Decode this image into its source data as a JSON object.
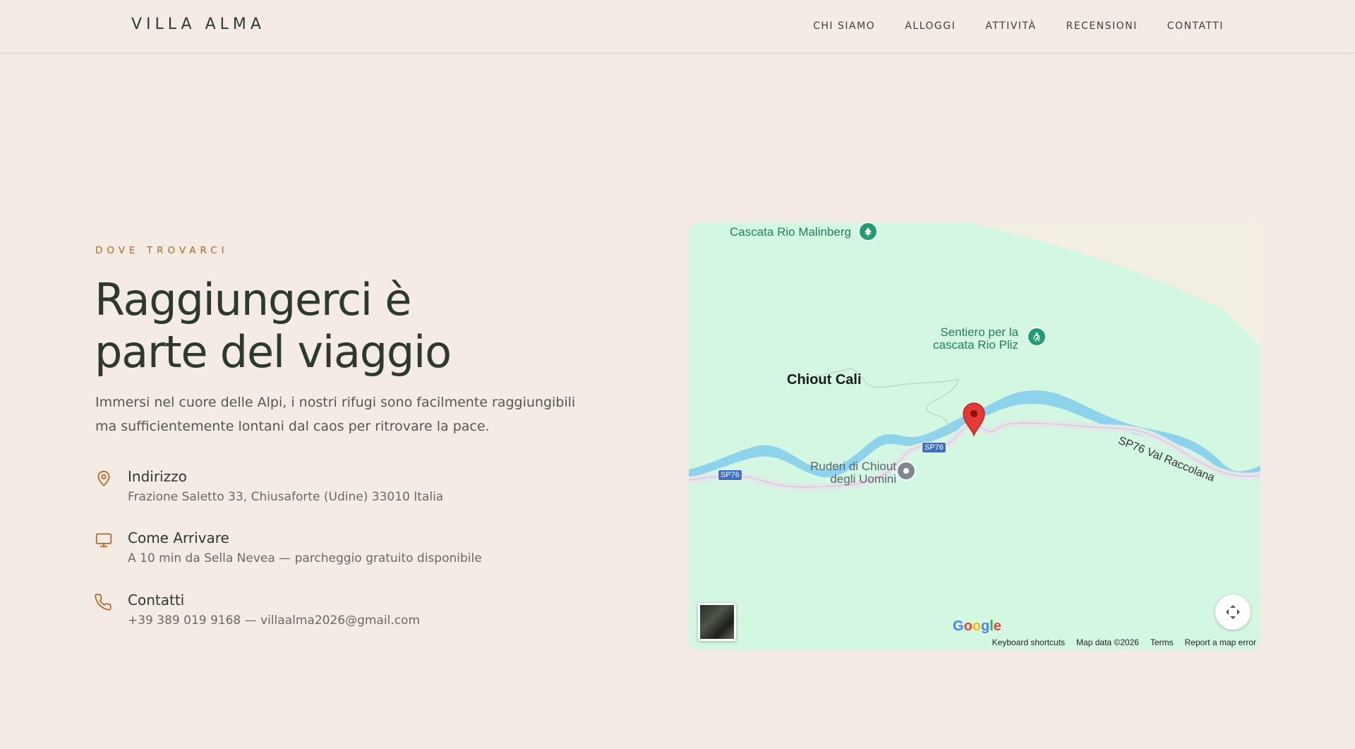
{
  "header": {
    "logo": "VILLA ALMA",
    "nav": [
      "CHI SIAMO",
      "ALLOGGI",
      "ATTIVITÀ",
      "RECENSIONI",
      "CONTATTI"
    ]
  },
  "section": {
    "eyebrow": "DOVE TROVARCI",
    "title_line1": "Raggiungerci è",
    "title_line2": "parte del viaggio",
    "lead_line1": "Immersi nel cuore delle Alpi, i nostri rifugi sono facilmente raggiungibili",
    "lead_line2": "ma sufficientemente lontani dal caos per ritrovare la pace."
  },
  "info": [
    {
      "icon": "map-pin-icon",
      "label": "Indirizzo",
      "value": "Frazione Saletto 33, Chiusaforte (Udine) 33010 Italia"
    },
    {
      "icon": "monitor-icon",
      "label": "Come Arrivare",
      "value": "A 10 min da Sella Nevea — parcheggio gratuito disponibile"
    },
    {
      "icon": "phone-icon",
      "label": "Contatti",
      "value": "+39 389 019 9168 — villaalma2026@gmail.com"
    }
  ],
  "map": {
    "labels": {
      "cascata": "Cascata Rio Malinberg",
      "sentiero_1": "Sentiero per la",
      "sentiero_2": "cascata Rio Pliz",
      "chiout": "Chiout Cali",
      "ruderi_1": "Ruderi di Chiout",
      "ruderi_2": "degli Uomini",
      "road_name": "SP76 Val Raccolana",
      "shield": "SP76"
    },
    "google": "Google",
    "attribution": [
      "Keyboard shortcuts",
      "Map data ©2026",
      "Terms",
      "Report a map error"
    ]
  },
  "colors": {
    "background": "#f3ebe4",
    "accent": "#b4661e",
    "heading": "#2d3a2a",
    "map_land": "#d4f7e2",
    "map_water": "#8dd3ec",
    "pin": "#e53935"
  }
}
